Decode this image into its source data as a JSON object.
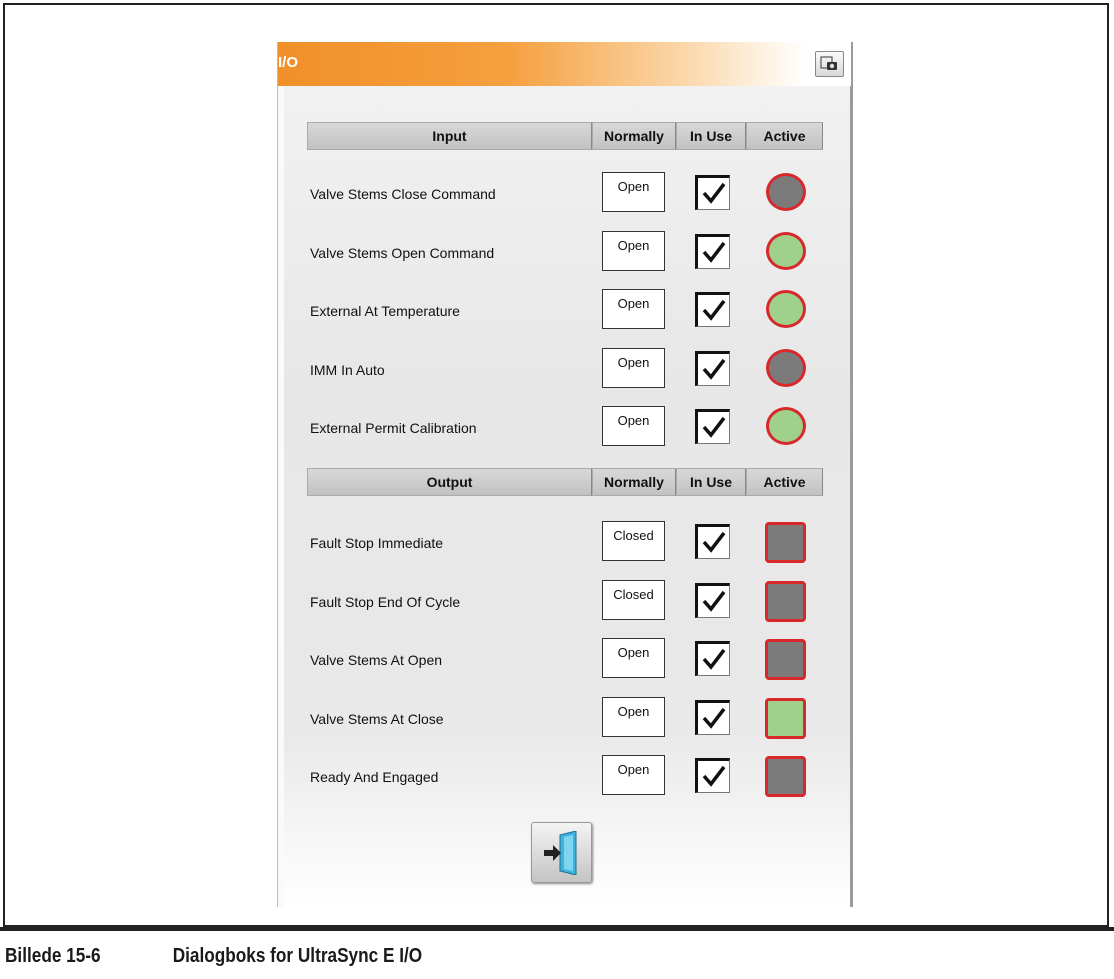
{
  "window": {
    "title": "I/O",
    "snapshot_icon": "camera-icon"
  },
  "input_headers": {
    "name": "Input",
    "normally": "Normally",
    "in_use": "In Use",
    "active": "Active"
  },
  "output_headers": {
    "name": "Output",
    "normally": "Normally",
    "in_use": "In Use",
    "active": "Active"
  },
  "inputs": [
    {
      "label": "Valve Stems Close Command",
      "normally": "Open",
      "in_use": true,
      "active": false
    },
    {
      "label": "Valve Stems Open Command",
      "normally": "Open",
      "in_use": true,
      "active": true
    },
    {
      "label": "External At Temperature",
      "normally": "Open",
      "in_use": true,
      "active": true
    },
    {
      "label": "IMM In Auto",
      "normally": "Open",
      "in_use": true,
      "active": false
    },
    {
      "label": "External Permit Calibration",
      "normally": "Open",
      "in_use": true,
      "active": true
    }
  ],
  "outputs": [
    {
      "label": "Fault Stop Immediate",
      "normally": "Closed",
      "in_use": true,
      "active": false
    },
    {
      "label": "Fault Stop End Of Cycle",
      "normally": "Closed",
      "in_use": true,
      "active": false
    },
    {
      "label": "Valve Stems At Open",
      "normally": "Open",
      "in_use": true,
      "active": false
    },
    {
      "label": "Valve Stems At Close",
      "normally": "Open",
      "in_use": true,
      "active": true
    },
    {
      "label": "Ready And Engaged",
      "normally": "Open",
      "in_use": true,
      "active": false
    }
  ],
  "colors": {
    "active_on": "#9fd18a",
    "active_off": "#7b7b7b",
    "led_border": "#d8282b",
    "title_accent": "#f0902a"
  },
  "exit_button": {
    "icon": "exit-door-icon"
  },
  "caption": {
    "number": "Billede 15-6",
    "text": "Dialogboks for UltraSync E I/O"
  }
}
